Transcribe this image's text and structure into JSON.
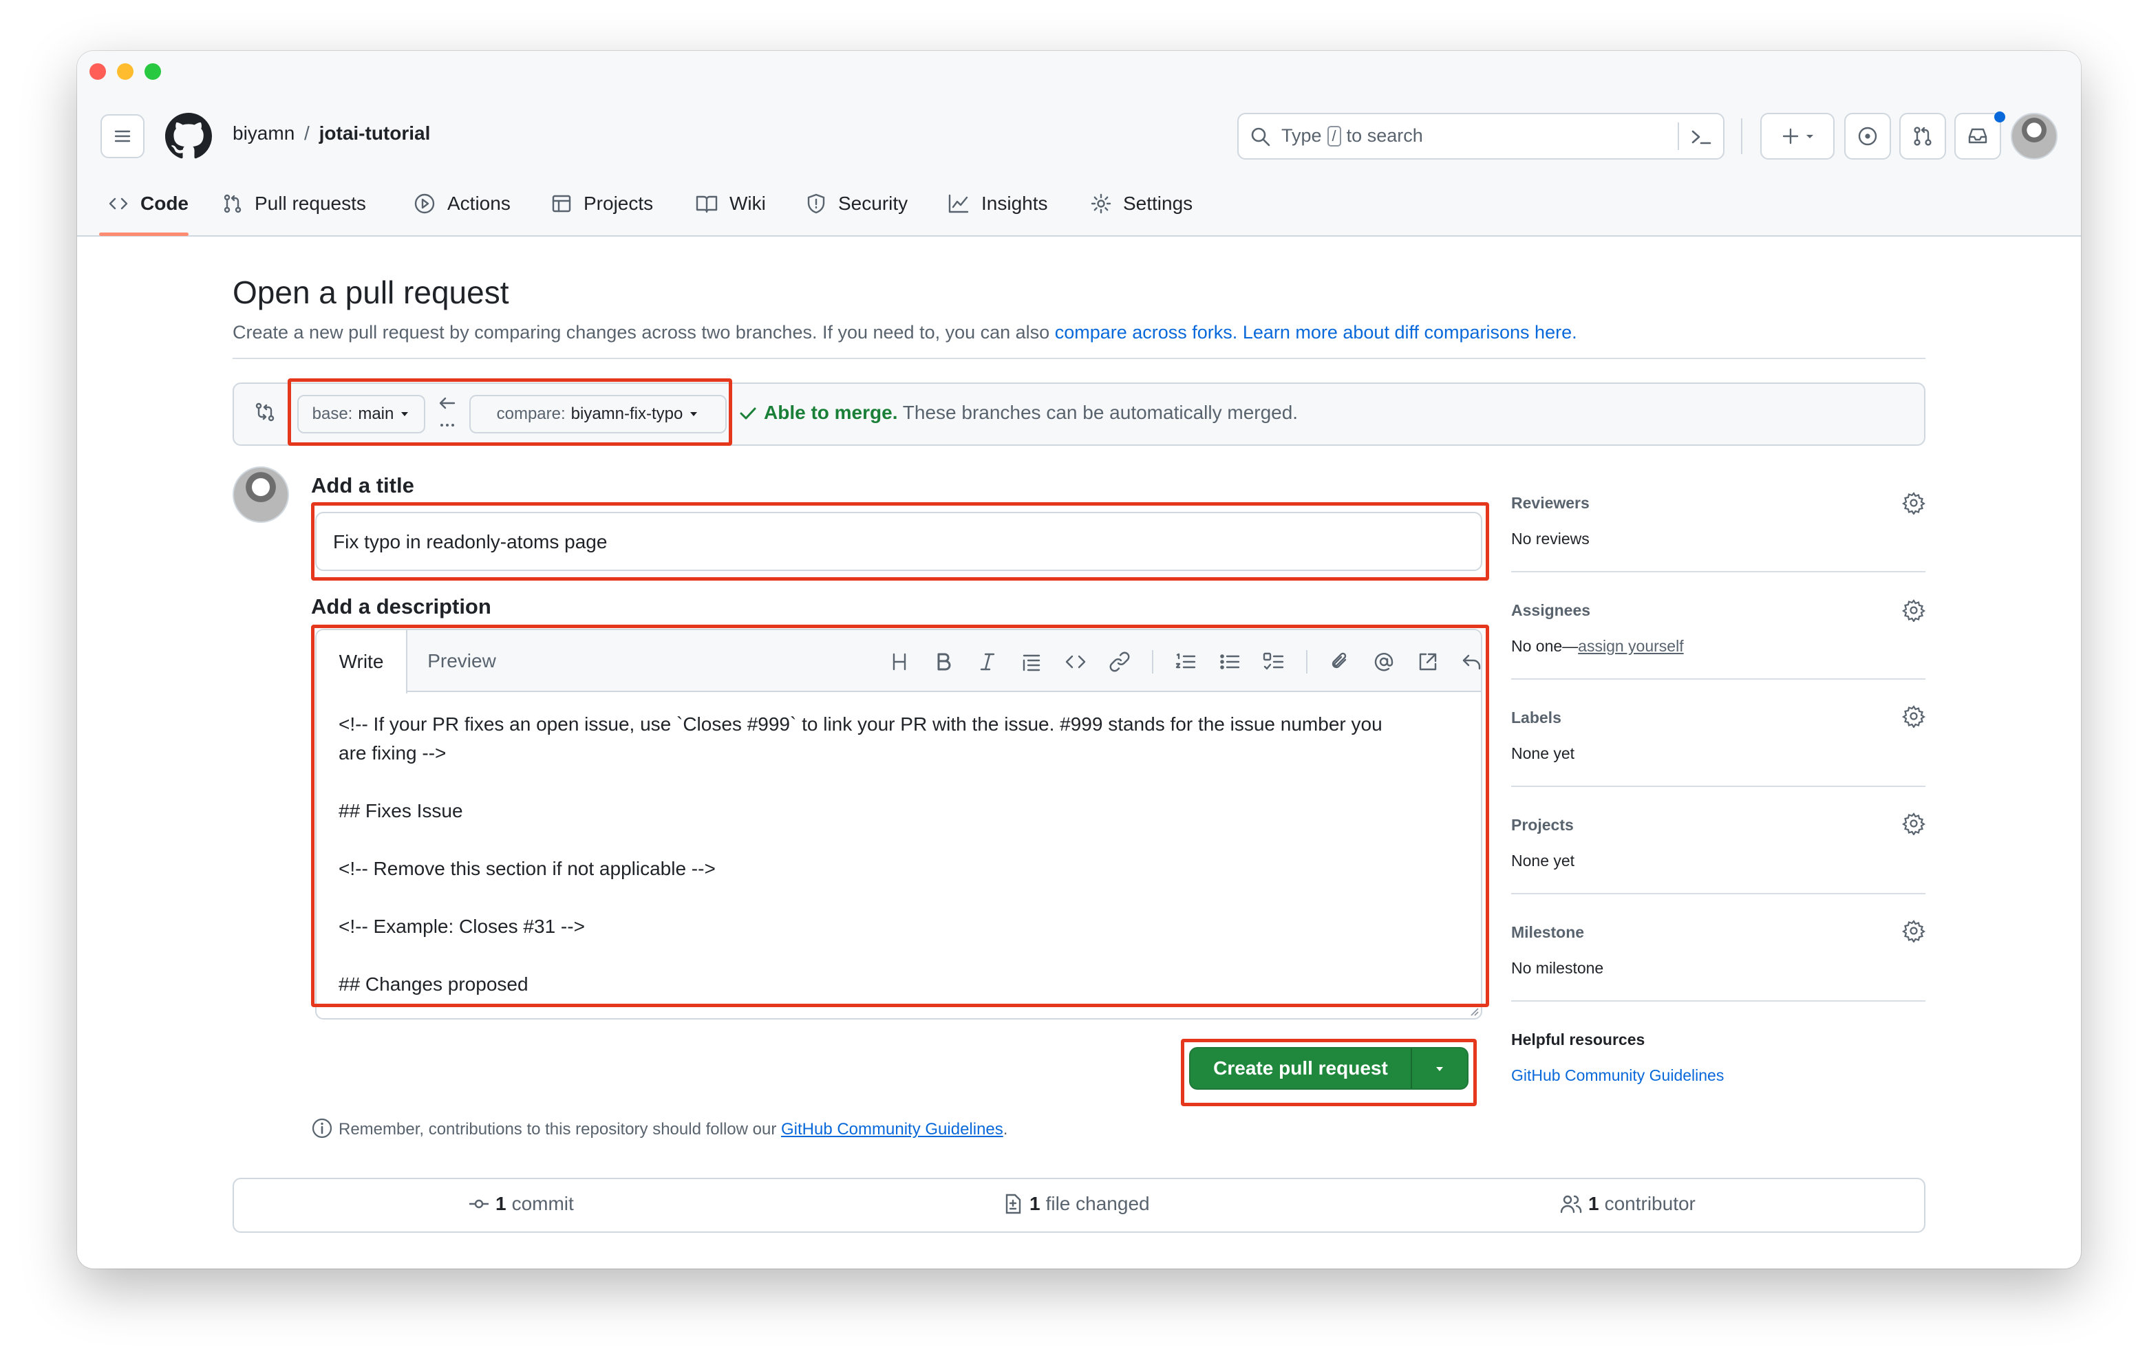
{
  "header": {
    "owner": "biyamn",
    "separator": "/",
    "repo": "jotai-tutorial",
    "search": {
      "prefix": "Type",
      "key": "/",
      "suffix": "to search"
    }
  },
  "nav": {
    "tabs": [
      {
        "label": "Code",
        "icon": "code-icon",
        "active": true
      },
      {
        "label": "Pull requests",
        "icon": "pull-request-icon"
      },
      {
        "label": "Actions",
        "icon": "play-icon"
      },
      {
        "label": "Projects",
        "icon": "table-icon"
      },
      {
        "label": "Wiki",
        "icon": "book-icon"
      },
      {
        "label": "Security",
        "icon": "shield-icon"
      },
      {
        "label": "Insights",
        "icon": "graph-icon"
      },
      {
        "label": "Settings",
        "icon": "gear-icon"
      }
    ]
  },
  "page": {
    "title": "Open a pull request",
    "subtitle_text": "Create a new pull request by comparing changes across two branches. If you need to, you can also",
    "subtitle_link1": "compare across forks.",
    "subtitle_link2": "Learn more about diff comparisons here."
  },
  "compare": {
    "base_label": "base:",
    "base_value": "main",
    "compare_label": "compare:",
    "compare_value": "biyamn-fix-typo",
    "merge_status": "Able to merge.",
    "merge_text": "These branches can be automatically merged."
  },
  "form": {
    "title_heading": "Add a title",
    "title_value": "Fix typo in readonly-atoms page",
    "description_heading": "Add a description",
    "tab_write": "Write",
    "tab_preview": "Preview",
    "toolbar_icons": [
      "heading-icon",
      "bold-icon",
      "italic-icon",
      "quote-icon",
      "code-icon",
      "link-icon",
      "ordered-list-icon",
      "unordered-list-icon",
      "task-list-icon",
      "attachment-icon",
      "mention-icon",
      "reference-icon",
      "undo-icon",
      "slash-command-icon"
    ],
    "description_lines": [
      "<!-- If your PR fixes an open issue, use `Closes #999` to link your PR with the issue. #999 stands for the issue number you",
      "are fixing -->",
      "",
      "## Fixes Issue",
      "",
      "<!-- Remove this section if not applicable -->",
      "",
      "<!-- Example: Closes #31 -->",
      "",
      "## Changes proposed"
    ],
    "submit_label": "Create pull request",
    "submit_color": "#1f883d",
    "guidelines_text": "Remember, contributions to this repository should follow our",
    "guidelines_link": "GitHub Community Guidelines",
    "guidelines_end": "."
  },
  "sidebar": {
    "reviewers_title": "Reviewers",
    "reviewers_value": "No reviews",
    "assignees_title": "Assignees",
    "assignees_value": "No one—",
    "assignees_link": "assign yourself",
    "labels_title": "Labels",
    "labels_value": "None yet",
    "projects_title": "Projects",
    "projects_value": "None yet",
    "milestone_title": "Milestone",
    "milestone_value": "No milestone",
    "helpful_title": "Helpful resources",
    "helpful_link": "GitHub Community Guidelines"
  },
  "stats": {
    "commits_count": "1",
    "commits_label": "commit",
    "files_count": "1",
    "files_label": "file changed",
    "contributors_count": "1",
    "contributors_label": "contributor"
  },
  "colors": {
    "accent": "#0969da",
    "success": "#1a7f37",
    "tab_underline": "#fd8c73",
    "highlight": "#e5371b"
  }
}
